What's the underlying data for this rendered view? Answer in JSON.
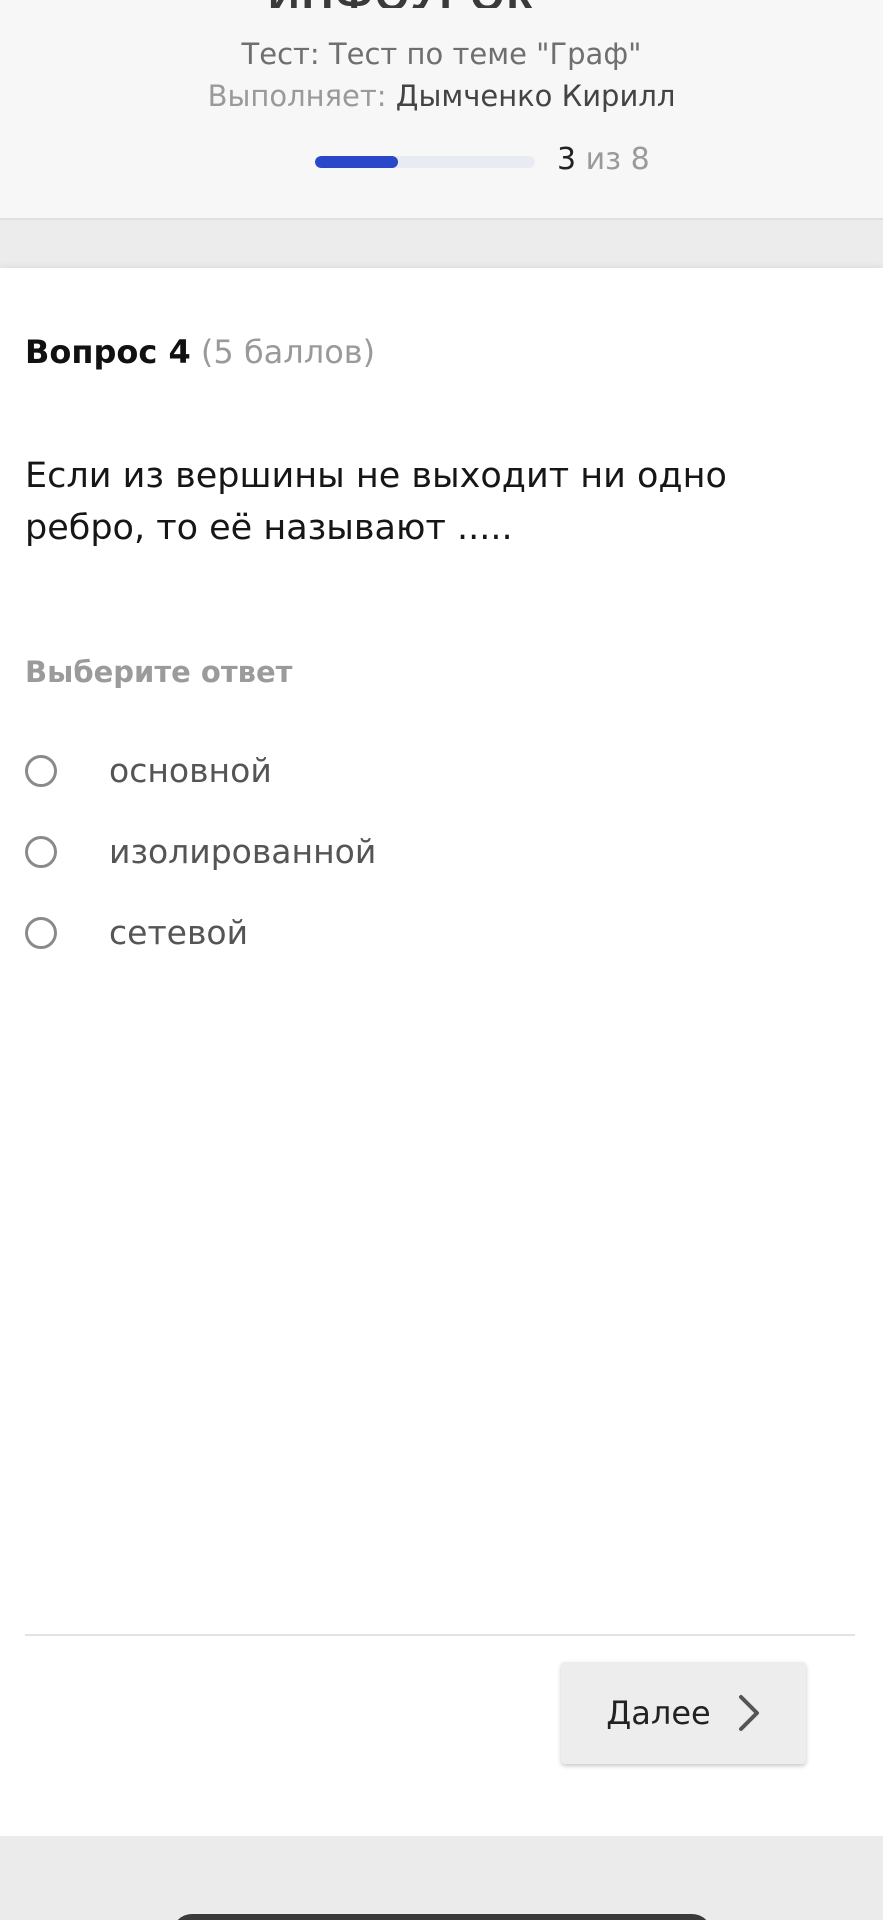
{
  "header": {
    "logo_text": "ИНФОУРОК",
    "test_label": "Тест:",
    "test_name": "Тест по теме \"Граф\"",
    "performer_label": "Выполняет:",
    "performer_name": "Дымченко Кирилл",
    "progress": {
      "current": "3",
      "separator": "из",
      "total": "8",
      "fraction": 0.375
    }
  },
  "question": {
    "number_label": "Вопрос 4",
    "points_label": "(5 баллов)",
    "text": "Если из вершины не выходит ни одно ребро, то её называют .....",
    "choose_label": "Выберите ответ",
    "options": [
      {
        "label": "основной",
        "selected": false
      },
      {
        "label": "изолированной",
        "selected": false
      },
      {
        "label": "сетевой",
        "selected": false
      }
    ]
  },
  "footer": {
    "next_label": "Далее",
    "next_icon": "chevron-right-icon"
  },
  "colors": {
    "accent": "#2a46c9",
    "progress_track": "#e8ebf2",
    "muted_text": "#9a9a9a"
  }
}
